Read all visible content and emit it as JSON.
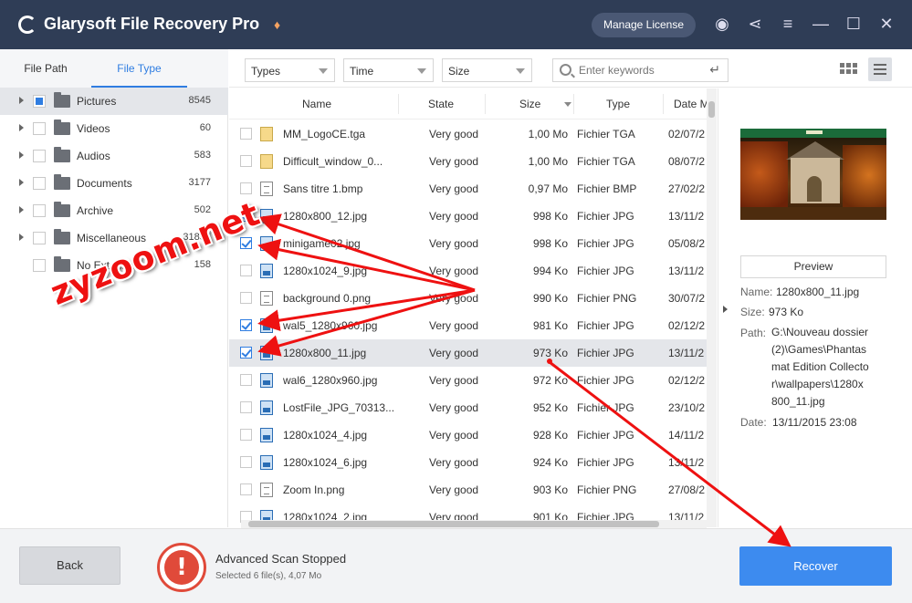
{
  "app": {
    "title": "Glarysoft File Recovery Pro",
    "manage_license": "Manage License"
  },
  "left_tabs": [
    {
      "label": "File Path"
    },
    {
      "label": "File Type"
    }
  ],
  "categories": [
    {
      "label": "Pictures",
      "count": "8545"
    },
    {
      "label": "Videos",
      "count": "60"
    },
    {
      "label": "Audios",
      "count": "583"
    },
    {
      "label": "Documents",
      "count": "3177"
    },
    {
      "label": "Archive",
      "count": "502"
    },
    {
      "label": "Miscellaneous",
      "count": "31857"
    },
    {
      "label": "No Extension",
      "count": "158"
    }
  ],
  "filters": {
    "types": "Types",
    "time": "Time",
    "size": "Size",
    "search_placeholder": "Enter keywords"
  },
  "columns": {
    "name": "Name",
    "state": "State",
    "size": "Size",
    "type": "Type",
    "date": "Date M"
  },
  "rows": [
    {
      "name": "MM_LogoCE.tga",
      "state": "Very good",
      "size": "1,00 Mo",
      "type": "Fichier TGA",
      "date": "02/07/2",
      "checked": false,
      "icon": "tga"
    },
    {
      "name": "Difficult_window_0...",
      "state": "Very good",
      "size": "1,00 Mo",
      "type": "Fichier TGA",
      "date": "08/07/2",
      "checked": false,
      "icon": "tga"
    },
    {
      "name": "Sans titre 1.bmp",
      "state": "Very good",
      "size": "0,97 Mo",
      "type": "Fichier BMP",
      "date": "27/02/2",
      "checked": false,
      "icon": "doc"
    },
    {
      "name": "1280x800_12.jpg",
      "state": "Very good",
      "size": "998 Ko",
      "type": "Fichier JPG",
      "date": "13/11/2",
      "checked": true,
      "icon": "jpg"
    },
    {
      "name": "minigame02.jpg",
      "state": "Very good",
      "size": "998 Ko",
      "type": "Fichier JPG",
      "date": "05/08/2",
      "checked": true,
      "icon": "jpg"
    },
    {
      "name": "1280x1024_9.jpg",
      "state": "Very good",
      "size": "994 Ko",
      "type": "Fichier JPG",
      "date": "13/11/2",
      "checked": false,
      "icon": "jpg"
    },
    {
      "name": "background 0.png",
      "state": "Very good",
      "size": "990 Ko",
      "type": "Fichier PNG",
      "date": "30/07/2",
      "checked": false,
      "icon": "doc"
    },
    {
      "name": "wal5_1280x960.jpg",
      "state": "Very good",
      "size": "981 Ko",
      "type": "Fichier JPG",
      "date": "02/12/2",
      "checked": true,
      "icon": "jpg"
    },
    {
      "name": "1280x800_11.jpg",
      "state": "Very good",
      "size": "973 Ko",
      "type": "Fichier JPG",
      "date": "13/11/2",
      "checked": true,
      "icon": "jpg",
      "highlighted": true
    },
    {
      "name": "wal6_1280x960.jpg",
      "state": "Very good",
      "size": "972 Ko",
      "type": "Fichier JPG",
      "date": "02/12/2",
      "checked": false,
      "icon": "jpg"
    },
    {
      "name": "LostFile_JPG_70313...",
      "state": "Very good",
      "size": "952 Ko",
      "type": "Fichier JPG",
      "date": "23/10/2",
      "checked": false,
      "icon": "jpg"
    },
    {
      "name": "1280x1024_4.jpg",
      "state": "Very good",
      "size": "928 Ko",
      "type": "Fichier JPG",
      "date": "14/11/2",
      "checked": false,
      "icon": "jpg"
    },
    {
      "name": "1280x1024_6.jpg",
      "state": "Very good",
      "size": "924 Ko",
      "type": "Fichier JPG",
      "date": "13/11/2",
      "checked": false,
      "icon": "jpg"
    },
    {
      "name": "Zoom In.png",
      "state": "Very good",
      "size": "903 Ko",
      "type": "Fichier PNG",
      "date": "27/08/2",
      "checked": false,
      "icon": "doc"
    },
    {
      "name": "1280x1024_2.jpg",
      "state": "Very good",
      "size": "901 Ko",
      "type": "Fichier JPG",
      "date": "13/11/2",
      "checked": false,
      "icon": "jpg"
    }
  ],
  "preview": {
    "button": "Preview",
    "name_label": "Name:",
    "name": "1280x800_11.jpg",
    "size_label": "Size:",
    "size": "973 Ko",
    "path_label": "Path:",
    "path_lines": [
      "G:\\Nouveau dossier",
      "(2)\\Games\\Phantas",
      "mat Edition Collecto",
      "r\\wallpapers\\1280x",
      "800_11.jpg"
    ],
    "date_label": "Date:",
    "date": "13/11/2015 23:08"
  },
  "footer": {
    "back": "Back",
    "status_title": "Advanced Scan Stopped",
    "status_sub": "Selected 6 file(s), 4,07 Mo",
    "recover": "Recover"
  },
  "watermark": "zyzoom.net",
  "colors": {
    "titlebar": "#2f3d56",
    "accent": "#2f7de1",
    "recover": "#3d8bef",
    "warning": "#e04a3a",
    "annotation": "#e11111"
  }
}
